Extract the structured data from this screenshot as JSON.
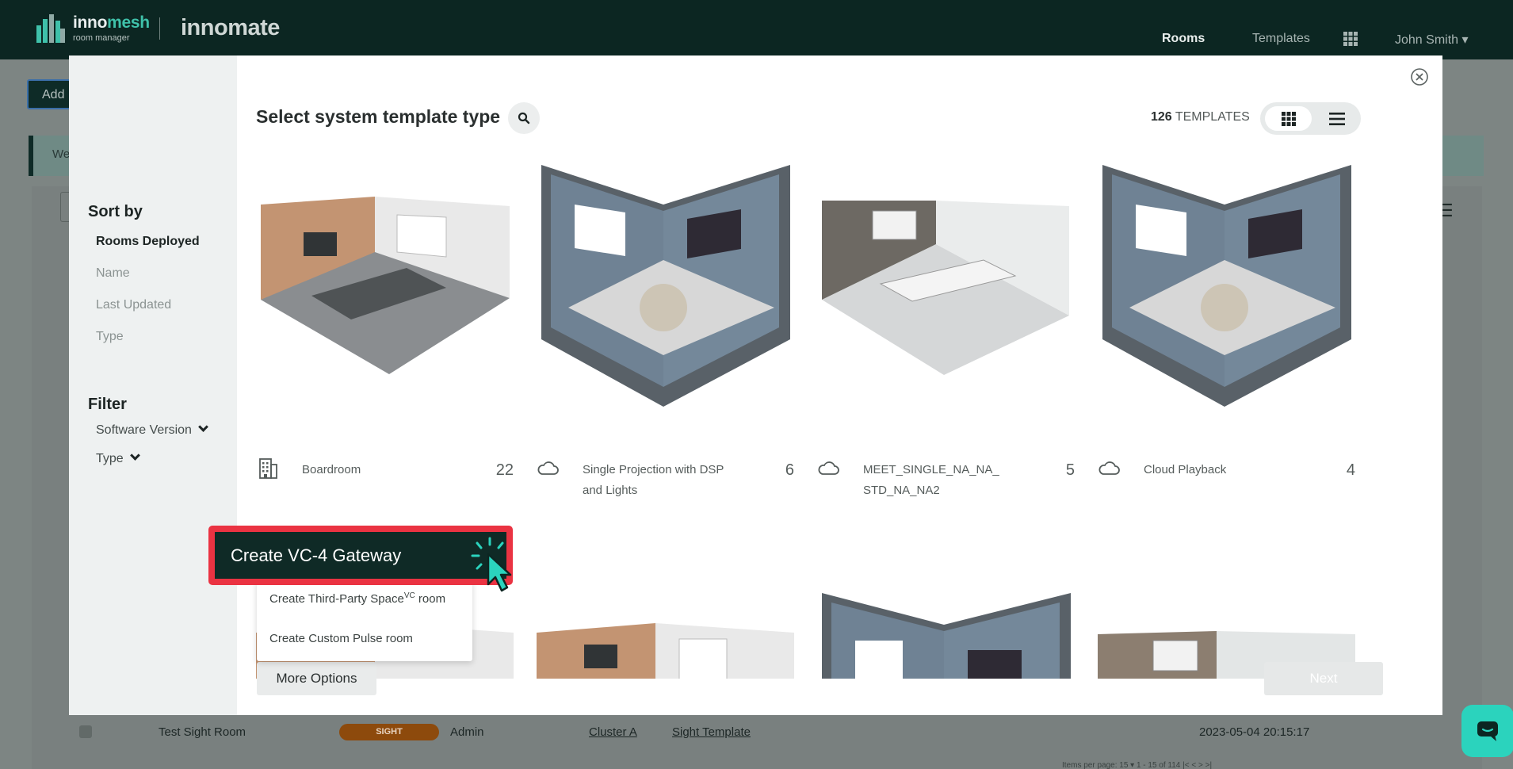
{
  "nav": {
    "logo_part1": "inno",
    "logo_part2": "mesh",
    "logo_sub": "room manager",
    "brand": "innomate",
    "links": {
      "rooms": "Rooms",
      "templates": "Templates"
    },
    "user": "John Smith ▾"
  },
  "background": {
    "add_button": "Add",
    "banner_text": "Wel",
    "row": {
      "name": "Test Sight Room",
      "badge": "SIGHT",
      "role": "Admin",
      "cluster": "Cluster A",
      "template": "Sight Template",
      "date": "2023-05-04 20:15:17"
    },
    "pager": "Items per page: 15  ▾     1 - 15 of 114     |<   <   >   >|"
  },
  "modal": {
    "title": "Select system template type",
    "count_number": "126",
    "count_label": "TEMPLATES",
    "sort": {
      "heading": "Sort by",
      "options": [
        "Rooms Deployed",
        "Name",
        "Last Updated",
        "Type"
      ],
      "active": "Rooms Deployed"
    },
    "filter": {
      "heading": "Filter",
      "options": [
        "Software Version",
        "Type"
      ]
    },
    "templates": [
      {
        "title": "Boardroom",
        "count": "22",
        "icon": "building-icon"
      },
      {
        "title": "Single Projection with DSP and Lights",
        "count": "6",
        "icon": "cloud-icon"
      },
      {
        "title": "MEET_SINGLE_NA_NA_ STD_NA_NA2",
        "count": "5",
        "icon": "cloud-icon"
      },
      {
        "title": "Cloud Playback",
        "count": "4",
        "icon": "cloud-icon"
      }
    ],
    "next_button": "Next",
    "more_button": "More Options",
    "dropdown": {
      "item1_pre": "Create Third-Party Space",
      "item1_sup": "VC",
      "item1_post": " room",
      "item2": "Create Custom Pulse room"
    },
    "highlight_label": "Create VC-4 Gateway"
  },
  "colors": {
    "nav_bg": "#0c2622",
    "accent": "#3fc1aa",
    "highlight_border": "#ea3342",
    "chat": "#2bd3bd"
  }
}
